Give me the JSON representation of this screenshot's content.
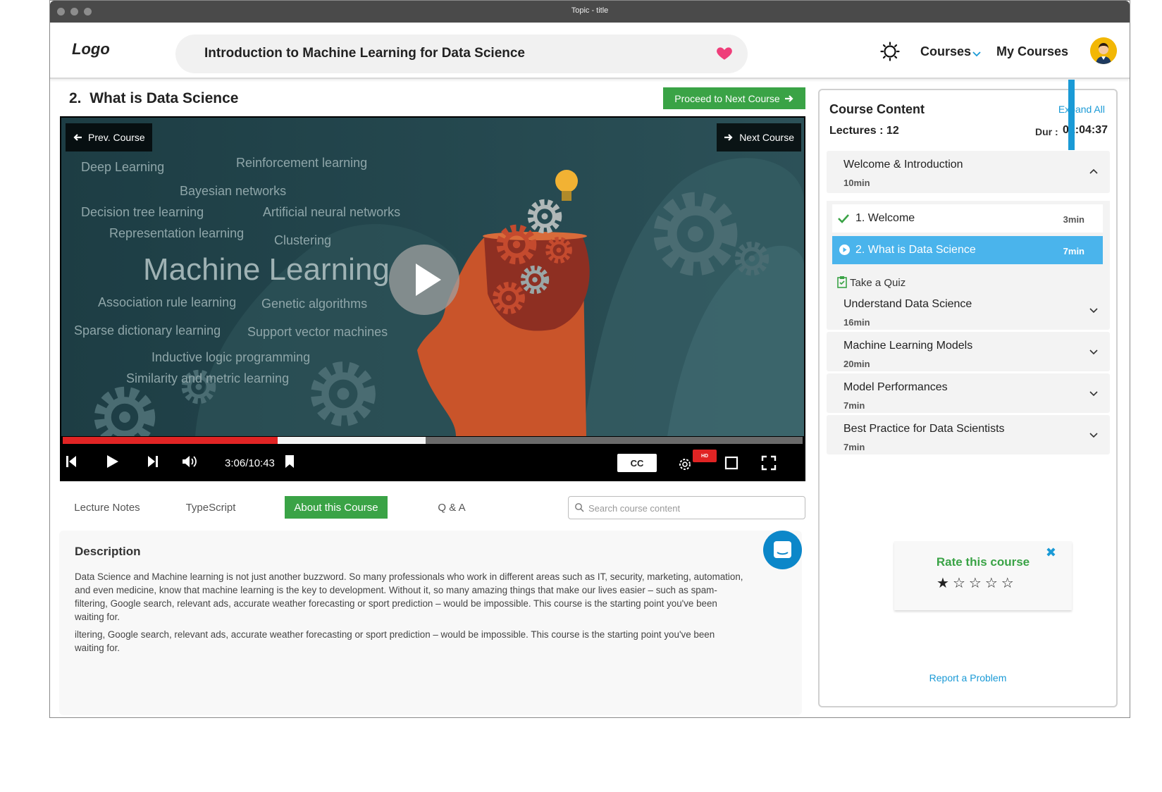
{
  "window": {
    "title": "Topic - title"
  },
  "header": {
    "logo": "Logo",
    "course_title": "Introduction to Machine Learning for Data Science",
    "nav_courses": "Courses",
    "nav_my_courses": "My Courses"
  },
  "lecture": {
    "number": "2.",
    "title": "What is Data Science",
    "proceed_label": "Proceed to Next Course"
  },
  "video": {
    "prev_label": "Prev. Course",
    "next_label": "Next Course",
    "time": "3:06/10:43",
    "played_fraction": 0.29,
    "buffered_fraction": 0.49,
    "cc_label": "CC",
    "hd_label": "HD",
    "art_words": [
      "Deep Learning",
      "Reinforcement learning",
      "Bayesian networks",
      "Decision tree learning",
      "Artificial neural networks",
      "Representation learning",
      "Clustering",
      "Machine Learning",
      "Association rule learning",
      "Genetic algorithms",
      "Sparse dictionary learning",
      "Support vector machines",
      "Inductive logic programming",
      "Similarity and metric learning"
    ]
  },
  "tabs": [
    {
      "label": "Lecture Notes"
    },
    {
      "label": "TypeScript"
    },
    {
      "label": "About this Course"
    },
    {
      "label": "Q & A"
    }
  ],
  "search": {
    "placeholder": "Search course content"
  },
  "description": {
    "heading": "Description",
    "p1": "Data Science and Machine learning is not just another buzzword. So many professionals who work in different areas such as IT, security, marketing, automation, and even medicine, know that machine learning is the key to development. Without it, so many amazing things that make our lives easier – such as spam-filtering, Google search, relevant ads, accurate weather forecasting or sport prediction – would be impossible. This course is the starting point you've been waiting for.",
    "p2": "iltering, Google search, relevant ads, accurate weather forecasting or sport prediction – would be impossible. This course is the starting point you've been waiting for."
  },
  "panel": {
    "title": "Course Content",
    "expand_all": "Expand All",
    "lectures": "Lectures : 12",
    "dur_label": "Dur :",
    "dur_value": "01:04:37",
    "sections": [
      {
        "title": "Welcome & Introduction",
        "duration": "10min"
      },
      {
        "title": "Understand Data Science",
        "duration": "16min"
      },
      {
        "title": "Machine Learning Models",
        "duration": "20min"
      },
      {
        "title": "Model Performances",
        "duration": "7min"
      },
      {
        "title": "Best Practice for Data Scientists",
        "duration": "7min"
      }
    ],
    "items": [
      {
        "title": "1. Welcome",
        "duration": "3min"
      },
      {
        "title": "2.  What is Data Science",
        "duration": "7min"
      }
    ],
    "quiz": "Take a Quiz",
    "rate_title": "Rate this course",
    "rating": 1,
    "rating_max": 5,
    "report": "Report a Problem"
  },
  "colors": {
    "accent_green": "#3aa346",
    "accent_blue": "#1a9ad6",
    "progress_red": "#e02424",
    "active_item": "#4ab4ec"
  }
}
